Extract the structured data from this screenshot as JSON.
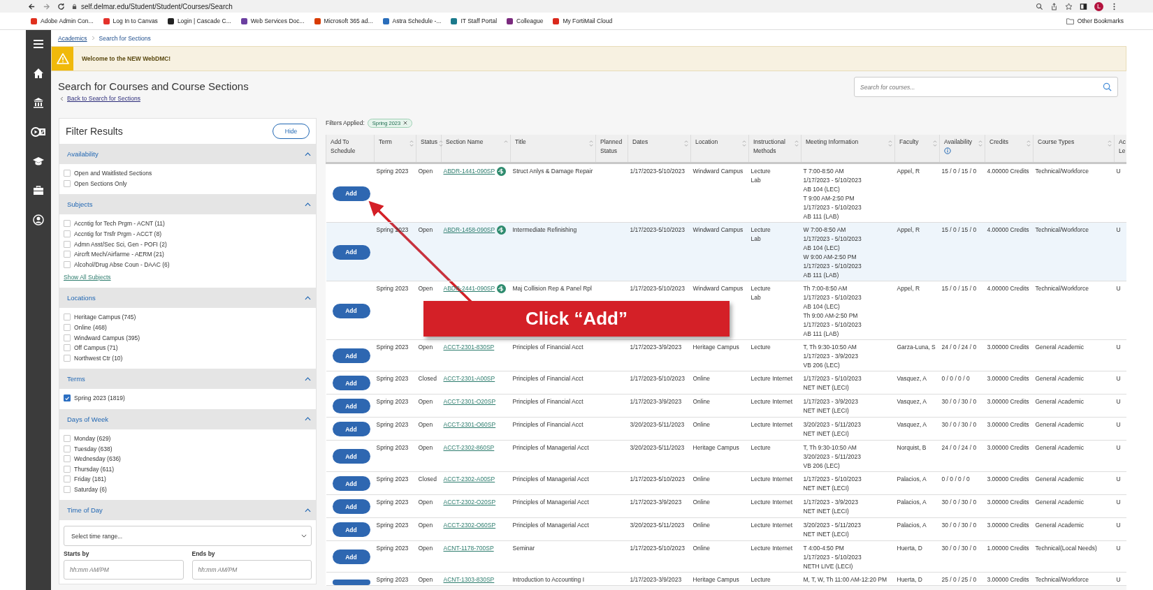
{
  "browser": {
    "url": "self.delmar.edu/Student/Student/Courses/Search",
    "profile_initial": "L",
    "other_bookmarks": "Other Bookmarks",
    "bookmarks": [
      {
        "label": "Adobe Admin Con...",
        "color": "#e0301e"
      },
      {
        "label": "Log In to Canvas",
        "color": "#e4312b"
      },
      {
        "label": "Login | Cascade C...",
        "color": "#222222"
      },
      {
        "label": "Web Services Doc...",
        "color": "#6b3fa0"
      },
      {
        "label": "Microsoft 365 ad...",
        "color": "#d83b01"
      },
      {
        "label": "Astra Schedule -...",
        "color": "#2a6ebb"
      },
      {
        "label": "IT Staff Portal",
        "color": "#1b7a8c"
      },
      {
        "label": "Colleague",
        "color": "#7a2a7e"
      },
      {
        "label": "My FortiMail Cloud",
        "color": "#da291c"
      }
    ]
  },
  "breadcrumbs": [
    {
      "label": "Academics",
      "kind": "link"
    },
    {
      "label": "Search for Sections",
      "kind": "current"
    }
  ],
  "banner": {
    "message": "Welcome to the NEW WebDMC!"
  },
  "page": {
    "title": "Search for Courses and Course Sections",
    "back_link": "Back to Search for Sections",
    "search_placeholder": "Search for courses..."
  },
  "filters": {
    "title": "Filter Results",
    "hide_button": "Hide",
    "sections": [
      {
        "title": "Availability",
        "kind": "checklist",
        "expanded": true,
        "options": [
          {
            "label": "Open and Waitlisted Sections",
            "checked": false
          },
          {
            "label": "Open Sections Only",
            "checked": false
          }
        ]
      },
      {
        "title": "Subjects",
        "kind": "checklist",
        "expanded": true,
        "show_all": "Show All Subjects",
        "options": [
          {
            "label": "Accntig for Tech Prgm - ACNT (11)",
            "checked": false
          },
          {
            "label": "Accntig for Trsfr Prgm - ACCT (8)",
            "checked": false
          },
          {
            "label": "Admn Asst/Sec Sci, Gen - POFI (2)",
            "checked": false
          },
          {
            "label": "Aircrft Mech/Airfarme - AERM (21)",
            "checked": false
          },
          {
            "label": "Alcohol/Drug Abse Coun - DAAC (6)",
            "checked": false
          }
        ]
      },
      {
        "title": "Locations",
        "kind": "checklist",
        "expanded": true,
        "options": [
          {
            "label": "Heritage Campus (745)",
            "checked": false
          },
          {
            "label": "Online (468)",
            "checked": false
          },
          {
            "label": "Windward Campus (395)",
            "checked": false
          },
          {
            "label": "Off Campus (71)",
            "checked": false
          },
          {
            "label": "Northwest Ctr (10)",
            "checked": false
          }
        ]
      },
      {
        "title": "Terms",
        "kind": "checklist",
        "expanded": true,
        "options": [
          {
            "label": "Spring 2023 (1819)",
            "checked": true
          }
        ]
      },
      {
        "title": "Days of Week",
        "kind": "checklist",
        "expanded": true,
        "options": [
          {
            "label": "Monday (629)",
            "checked": false
          },
          {
            "label": "Tuesday (638)",
            "checked": false
          },
          {
            "label": "Wednesday (636)",
            "checked": false
          },
          {
            "label": "Thursday (611)",
            "checked": false
          },
          {
            "label": "Friday (181)",
            "checked": false
          },
          {
            "label": "Saturday (6)",
            "checked": false
          }
        ]
      },
      {
        "title": "Time of Day",
        "kind": "time",
        "expanded": true,
        "select_value": "Select time range...",
        "starts_label": "Starts by",
        "starts_placeholder": "hh:mm AM/PM",
        "ends_label": "Ends by",
        "ends_placeholder": "hh:mm AM/PM"
      }
    ]
  },
  "results": {
    "filters_label": "Filters Applied:",
    "applied_filters": [
      "Spring 2023"
    ],
    "columns": [
      {
        "label": "Add To Schedule",
        "sortable": false,
        "sorted": false
      },
      {
        "label": "Term",
        "sortable": true,
        "sorted": false
      },
      {
        "label": "Status",
        "sortable": true,
        "sorted": false
      },
      {
        "label": "Section Name",
        "sortable": true,
        "sorted": true
      },
      {
        "label": "Title",
        "sortable": true,
        "sorted": false
      },
      {
        "label": "Planned Status",
        "sortable": false,
        "sorted": false
      },
      {
        "label": "Dates",
        "sortable": true,
        "sorted": false
      },
      {
        "label": "Location",
        "sortable": true,
        "sorted": false
      },
      {
        "label": "Instructional Methods",
        "sortable": true,
        "sorted": false
      },
      {
        "label": "Meeting Information",
        "sortable": true,
        "sorted": false
      },
      {
        "label": "Faculty",
        "sortable": true,
        "sorted": false
      },
      {
        "label": "Availability",
        "sortable": true,
        "sorted": false,
        "info": true
      },
      {
        "label": "Credits",
        "sortable": true,
        "sorted": false
      },
      {
        "label": "Course Types",
        "sortable": true,
        "sorted": false
      },
      {
        "label": "Ac Le"
      }
    ],
    "rows": [
      {
        "add_button": "Add",
        "term": "Spring 2023",
        "status": "Open",
        "section": "ABDR-1441-090SP",
        "fee": true,
        "title": "Struct Anlys & Damage Repair",
        "dates": "1/17/2023-5/10/2023",
        "location": "Windward Campus",
        "methods": [
          "Lecture",
          "Lab"
        ],
        "meeting": [
          "T 7:00-8:50 AM",
          "1/17/2023 - 5/10/2023",
          "AB 104 (LEC)",
          "T 9:00 AM-2:50 PM",
          "1/17/2023 - 5/10/2023",
          "AB 111 (LAB)"
        ],
        "faculty": "Appel, R",
        "availability": "15 / 0 / 15 / 0",
        "credits": "4.00000 Credits",
        "course_types": "Technical/Workforce",
        "column_15": "U",
        "hovered": false
      },
      {
        "add_button": "Add",
        "term": "Spring 2023",
        "status": "Open",
        "section": "ABDR-1458-090SP",
        "fee": true,
        "title": "Intermediate Refinishing",
        "dates": "1/17/2023-5/10/2023",
        "location": "Windward Campus",
        "methods": [
          "Lecture",
          "Lab"
        ],
        "meeting": [
          "W 7:00-8:50 AM",
          "1/17/2023 - 5/10/2023",
          "AB 104 (LEC)",
          "W 9:00 AM-2:50 PM",
          "1/17/2023 - 5/10/2023",
          "AB 111 (LAB)"
        ],
        "faculty": "Appel, R",
        "availability": "15 / 0 / 15 / 0",
        "credits": "4.00000 Credits",
        "course_types": "Technical/Workforce",
        "column_15": "U",
        "hovered": true
      },
      {
        "add_button": "Add",
        "term": "Spring 2023",
        "status": "Open",
        "section": "ABDR-2441-090SP",
        "fee": true,
        "title": "Maj Collision Rep & Panel Rpl",
        "dates": "1/17/2023-5/10/2023",
        "location": "Windward Campus",
        "methods": [
          "Lecture",
          "Lab"
        ],
        "meeting": [
          "Th 7:00-8:50 AM",
          "1/17/2023 - 5/10/2023",
          "AB 104 (LEC)",
          "Th 9:00 AM-2:50 PM",
          "1/17/2023 - 5/10/2023",
          "AB 111 (LAB)"
        ],
        "faculty": "Appel, R",
        "availability": "15 / 0 / 15 / 0",
        "credits": "4.00000 Credits",
        "course_types": "Technical/Workforce",
        "column_15": "U",
        "hovered": false
      },
      {
        "add_button": "Add",
        "term": "Spring 2023",
        "status": "Open",
        "section": "ACCT-2301-830SP",
        "fee": false,
        "title": "Principles of Financial Acct",
        "dates": "1/17/2023-3/9/2023",
        "location": "Heritage Campus",
        "methods": [
          "Lecture"
        ],
        "meeting": [
          "T, Th 9:30-10:50 AM",
          "1/17/2023 - 3/9/2023",
          "VB 206 (LEC)"
        ],
        "faculty": "Garza-Luna, S",
        "availability": "24 / 0 / 24 / 0",
        "credits": "3.00000 Credits",
        "course_types": "General Academic",
        "column_15": "U",
        "hovered": false
      },
      {
        "add_button": "Add",
        "term": "Spring 2023",
        "status": "Closed",
        "section": "ACCT-2301-A00SP",
        "fee": false,
        "title": "Principles of Financial Acct",
        "dates": "1/17/2023-5/10/2023",
        "location": "Online",
        "methods": [
          "Lecture Internet"
        ],
        "meeting": [
          "1/17/2023 - 5/10/2023",
          "NET INET (LECI)"
        ],
        "faculty": "Vasquez, A",
        "availability": "0 / 0 / 0 / 0",
        "credits": "3.00000 Credits",
        "course_types": "General Academic",
        "column_15": "U",
        "hovered": false
      },
      {
        "add_button": "Add",
        "term": "Spring 2023",
        "status": "Open",
        "section": "ACCT-2301-O20SP",
        "fee": false,
        "title": "Principles of Financial Acct",
        "dates": "1/17/2023-3/9/2023",
        "location": "Online",
        "methods": [
          "Lecture Internet"
        ],
        "meeting": [
          "1/17/2023 - 3/9/2023",
          "NET INET (LECI)"
        ],
        "faculty": "Vasquez, A",
        "availability": "30 / 0 / 30 / 0",
        "credits": "3.00000 Credits",
        "course_types": "General Academic",
        "column_15": "U",
        "hovered": false
      },
      {
        "add_button": "Add",
        "term": "Spring 2023",
        "status": "Open",
        "section": "ACCT-2301-O60SP",
        "fee": false,
        "title": "Principles of Financial Acct",
        "dates": "3/20/2023-5/11/2023",
        "location": "Online",
        "methods": [
          "Lecture Internet"
        ],
        "meeting": [
          "3/20/2023 - 5/11/2023",
          "NET INET (LECI)"
        ],
        "faculty": "Vasquez, A",
        "availability": "30 / 0 / 30 / 0",
        "credits": "3.00000 Credits",
        "course_types": "General Academic",
        "column_15": "U",
        "hovered": false
      },
      {
        "add_button": "Add",
        "term": "Spring 2023",
        "status": "Open",
        "section": "ACCT-2302-860SP",
        "fee": false,
        "title": "Principles of Managerial Acct",
        "dates": "3/20/2023-5/11/2023",
        "location": "Heritage Campus",
        "methods": [
          "Lecture"
        ],
        "meeting": [
          "T, Th 9:30-10:50 AM",
          "3/20/2023 - 5/11/2023",
          "VB 206 (LEC)"
        ],
        "faculty": "Norquist, B",
        "availability": "24 / 0 / 24 / 0",
        "credits": "3.00000 Credits",
        "course_types": "General Academic",
        "column_15": "U",
        "hovered": false
      },
      {
        "add_button": "Add",
        "term": "Spring 2023",
        "status": "Closed",
        "section": "ACCT-2302-A00SP",
        "fee": false,
        "title": "Principles of Managerial Acct",
        "dates": "1/17/2023-5/10/2023",
        "location": "Online",
        "methods": [
          "Lecture Internet"
        ],
        "meeting": [
          "1/17/2023 - 5/10/2023",
          "NET INET (LECI)"
        ],
        "faculty": "Palacios, A",
        "availability": "0 / 0 / 0 / 0",
        "credits": "3.00000 Credits",
        "course_types": "General Academic",
        "column_15": "U",
        "hovered": false
      },
      {
        "add_button": "Add",
        "term": "Spring 2023",
        "status": "Open",
        "section": "ACCT-2302-O20SP",
        "fee": false,
        "title": "Principles of Managerial Acct",
        "dates": "1/17/2023-3/9/2023",
        "location": "Online",
        "methods": [
          "Lecture Internet"
        ],
        "meeting": [
          "1/17/2023 - 3/9/2023",
          "NET INET (LECI)"
        ],
        "faculty": "Palacios, A",
        "availability": "30 / 0 / 30 / 0",
        "credits": "3.00000 Credits",
        "course_types": "General Academic",
        "column_15": "U",
        "hovered": false
      },
      {
        "add_button": "Add",
        "term": "Spring 2023",
        "status": "Open",
        "section": "ACCT-2302-O60SP",
        "fee": false,
        "title": "Principles of Managerial Acct",
        "dates": "3/20/2023-5/11/2023",
        "location": "Online",
        "methods": [
          "Lecture Internet"
        ],
        "meeting": [
          "3/20/2023 - 5/11/2023",
          "NET INET (LECI)"
        ],
        "faculty": "Palacios, A",
        "availability": "30 / 0 / 30 / 0",
        "credits": "3.00000 Credits",
        "course_types": "General Academic",
        "column_15": "U",
        "hovered": false
      },
      {
        "add_button": "Add",
        "term": "Spring 2023",
        "status": "Open",
        "section": "ACNT-1178-700SP",
        "fee": false,
        "title": "Seminar",
        "dates": "1/17/2023-5/10/2023",
        "location": "Online",
        "methods": [
          "Lecture Internet"
        ],
        "meeting": [
          "T 4:00-4:50 PM",
          "1/17/2023 - 5/10/2023",
          "NETH LIVE (LECI)"
        ],
        "faculty": "Huerta, D",
        "availability": "30 / 0 / 30 / 0",
        "credits": "1.00000 Credits",
        "course_types": "Technical(Local Needs)",
        "column_15": "U",
        "hovered": false
      },
      {
        "term": "Spring 2023",
        "status": "Open",
        "section": "ACNT-1303-830SP",
        "fee": false,
        "title": "Introduction to Accounting I",
        "dates": "1/17/2023-3/9/2023",
        "location": "Heritage Campus",
        "methods": [
          "Lecture"
        ],
        "meeting": [
          "M, T, W, Th 11:00 AM-12:20 PM"
        ],
        "faculty": "Huerta, D",
        "availability": "25 / 0 / 25 / 0",
        "credits": "3.00000 Credits",
        "course_types": "Technical/Workforce",
        "column_15": "U",
        "hovered": false
      }
    ]
  },
  "callout": {
    "text": "Click “Add”"
  }
}
